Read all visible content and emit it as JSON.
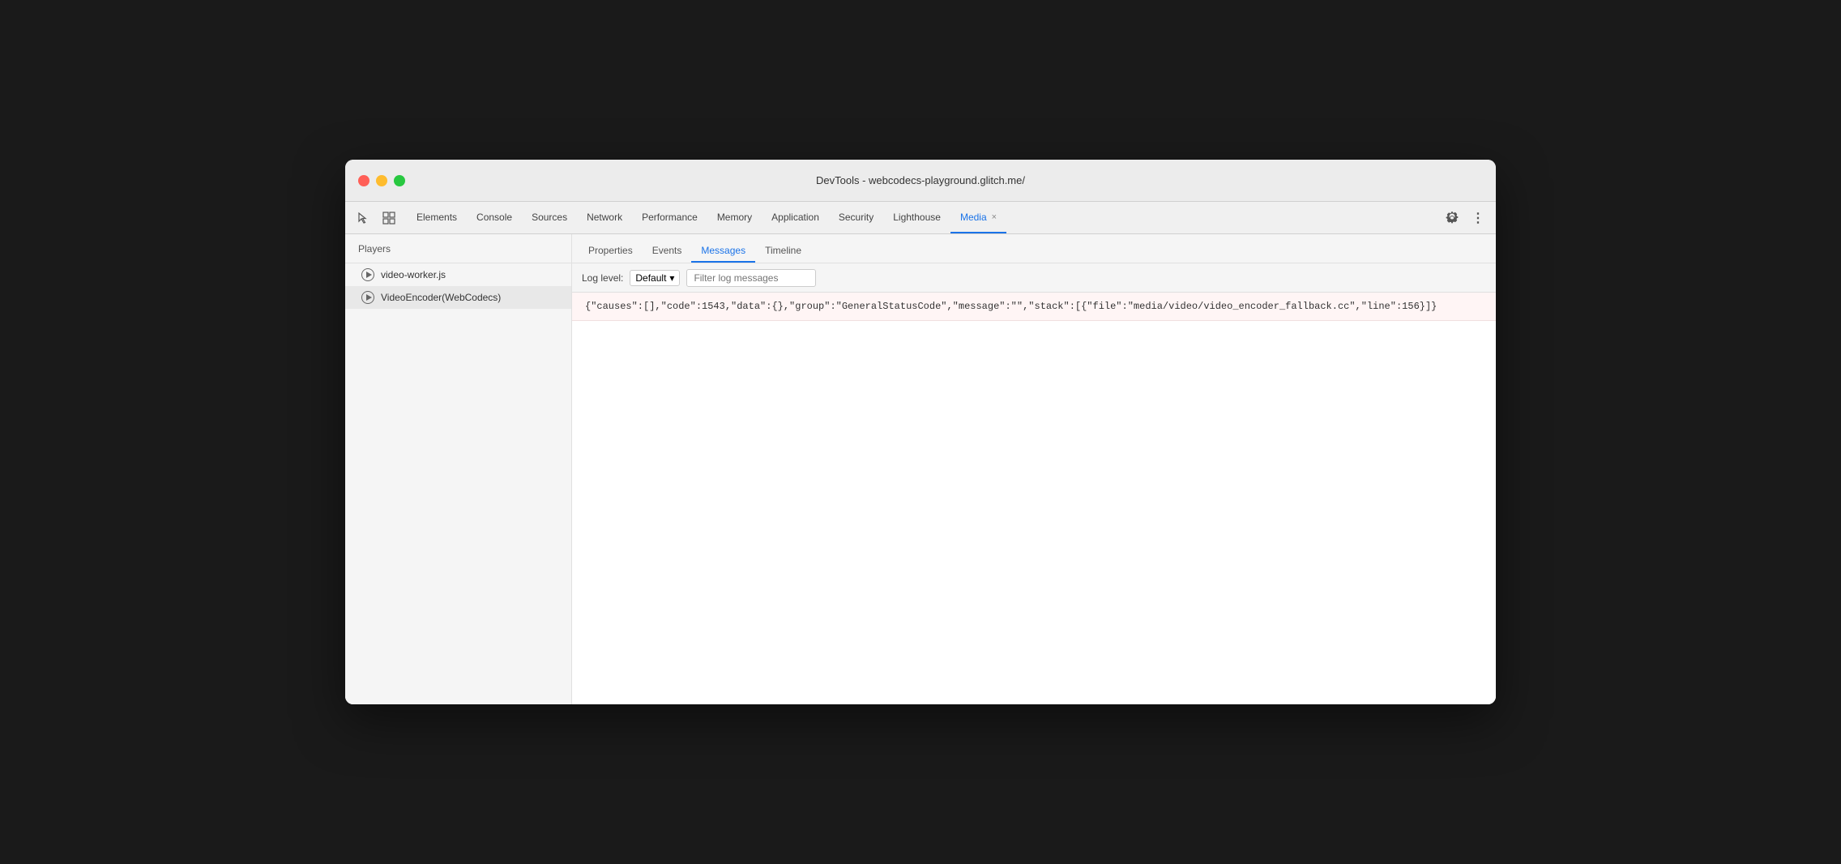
{
  "window": {
    "title": "DevTools - webcodecs-playground.glitch.me/"
  },
  "nav": {
    "tabs": [
      {
        "label": "Elements",
        "active": false
      },
      {
        "label": "Console",
        "active": false
      },
      {
        "label": "Sources",
        "active": false
      },
      {
        "label": "Network",
        "active": false
      },
      {
        "label": "Performance",
        "active": false
      },
      {
        "label": "Memory",
        "active": false
      },
      {
        "label": "Application",
        "active": false
      },
      {
        "label": "Security",
        "active": false
      },
      {
        "label": "Lighthouse",
        "active": false
      },
      {
        "label": "Media",
        "active": true,
        "closeable": true
      }
    ]
  },
  "sidebar": {
    "header": "Players",
    "items": [
      {
        "label": "video-worker.js",
        "selected": false
      },
      {
        "label": "VideoEncoder(WebCodecs)",
        "selected": true
      }
    ]
  },
  "panel": {
    "tabs": [
      {
        "label": "Properties",
        "active": false
      },
      {
        "label": "Events",
        "active": false
      },
      {
        "label": "Messages",
        "active": true
      },
      {
        "label": "Timeline",
        "active": false
      }
    ],
    "toolbar": {
      "log_level_label": "Log level:",
      "log_level_value": "Default",
      "filter_placeholder": "Filter log messages"
    },
    "messages": [
      {
        "text": "{\"causes\":[],\"code\":1543,\"data\":{},\"group\":\"GeneralStatusCode\",\"message\":\"\",\"stack\":[{\"file\":\"media/video/video_encoder_fallback.cc\",\"line\":156}]}"
      }
    ]
  },
  "icons": {
    "cursor": "⬚",
    "inspect": "☐",
    "gear": "⚙",
    "more": "⋮",
    "chevron_down": "▾",
    "close": "×"
  }
}
